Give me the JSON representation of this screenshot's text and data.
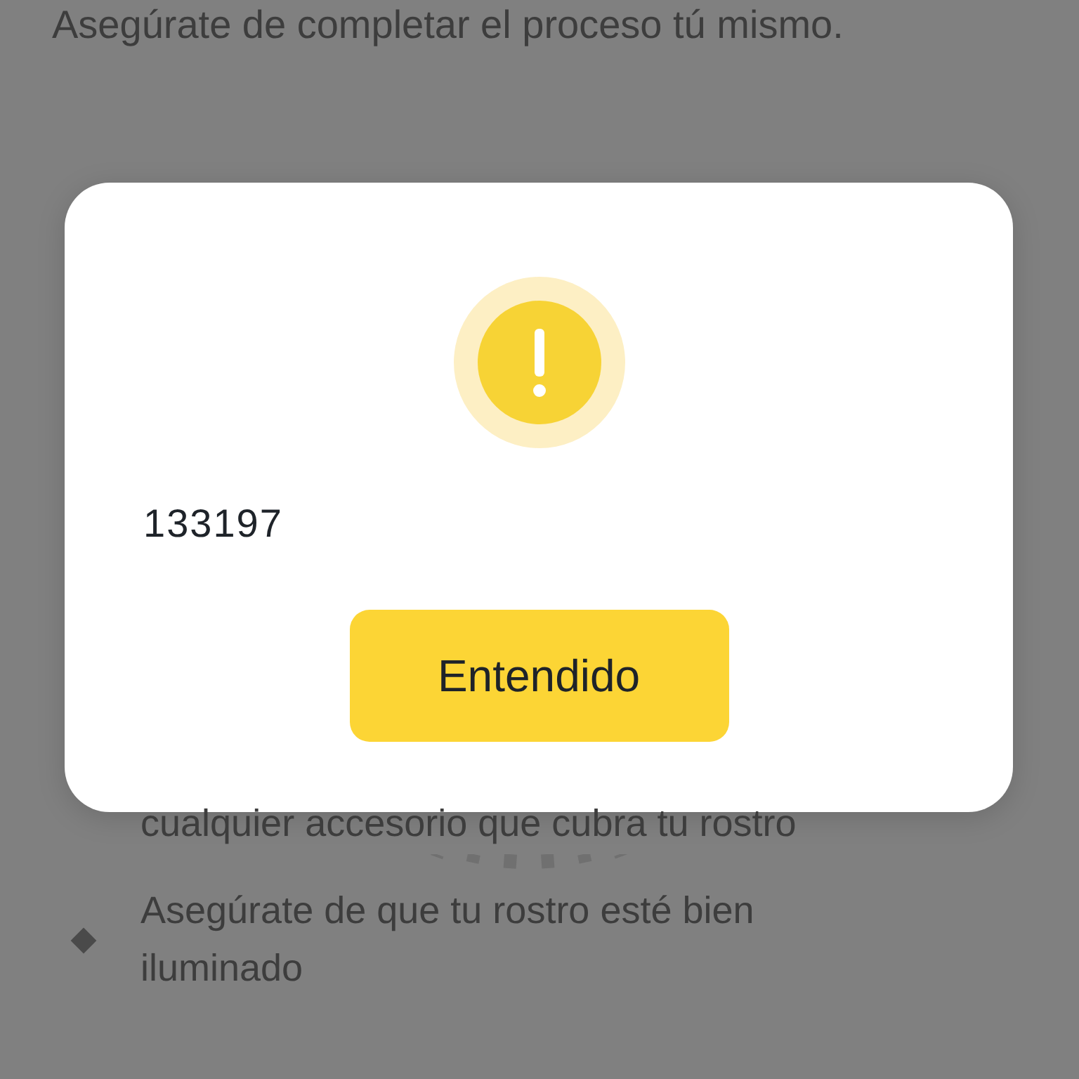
{
  "background": {
    "intro": "Asegúrate de completar el proceso tú mismo.",
    "tips": [
      {
        "kind": "continuation",
        "text": "cualquier accesorio que cubra tu rostro"
      },
      {
        "kind": "bullet",
        "text": "Asegúrate de que tu rostro esté bien iluminado"
      }
    ]
  },
  "dialog": {
    "message": "133197",
    "button": "Entendido"
  }
}
